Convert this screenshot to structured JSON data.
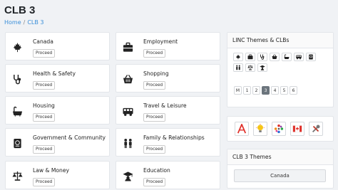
{
  "page": {
    "title": "CLB 3"
  },
  "breadcrumb": {
    "home": "Home",
    "separator": "/",
    "current": "CLB 3"
  },
  "cards": [
    {
      "title": "Canada",
      "button": "Proceed",
      "icon": "maple-leaf-icon"
    },
    {
      "title": "Employment",
      "button": "Proceed",
      "icon": "briefcase-icon"
    },
    {
      "title": "Health & Safety",
      "button": "Proceed",
      "icon": "stethoscope-icon"
    },
    {
      "title": "Shopping",
      "button": "Proceed",
      "icon": "shopping-basket-icon"
    },
    {
      "title": "Housing",
      "button": "Proceed",
      "icon": "bathtub-icon"
    },
    {
      "title": "Travel & Leisure",
      "button": "Proceed",
      "icon": "bus-icon"
    },
    {
      "title": "Government & Community",
      "button": "Proceed",
      "icon": "passport-icon"
    },
    {
      "title": "Family & Relationships",
      "button": "Proceed",
      "icon": "people-icon"
    },
    {
      "title": "Law & Money",
      "button": "Proceed",
      "icon": "balance-scale-icon"
    },
    {
      "title": "Education",
      "button": "Proceed",
      "icon": "graduation-cap-icon"
    }
  ],
  "linc_panel": {
    "title": "LINC Themes & CLBs",
    "theme_icons": [
      "maple-leaf-icon",
      "briefcase-icon",
      "stethoscope-icon",
      "shopping-basket-icon",
      "bathtub-icon",
      "bus-icon",
      "passport-icon",
      "people-icon",
      "balance-scale-icon",
      "graduation-cap-icon"
    ],
    "pager": [
      "M",
      "1",
      "2",
      "3",
      "4",
      "5",
      "6"
    ],
    "active_page": "3"
  },
  "badges": [
    "letter-a-icon",
    "lightbulb-icon",
    "pinwheel-icon",
    "canada-flag-icon",
    "tools-icon"
  ],
  "clb_panel": {
    "title": "CLB 3 Themes",
    "button": "Canada"
  },
  "colors": {
    "link": "#3a8fd9",
    "active_page": "#6c757d",
    "accent_red": "#e0312b"
  }
}
